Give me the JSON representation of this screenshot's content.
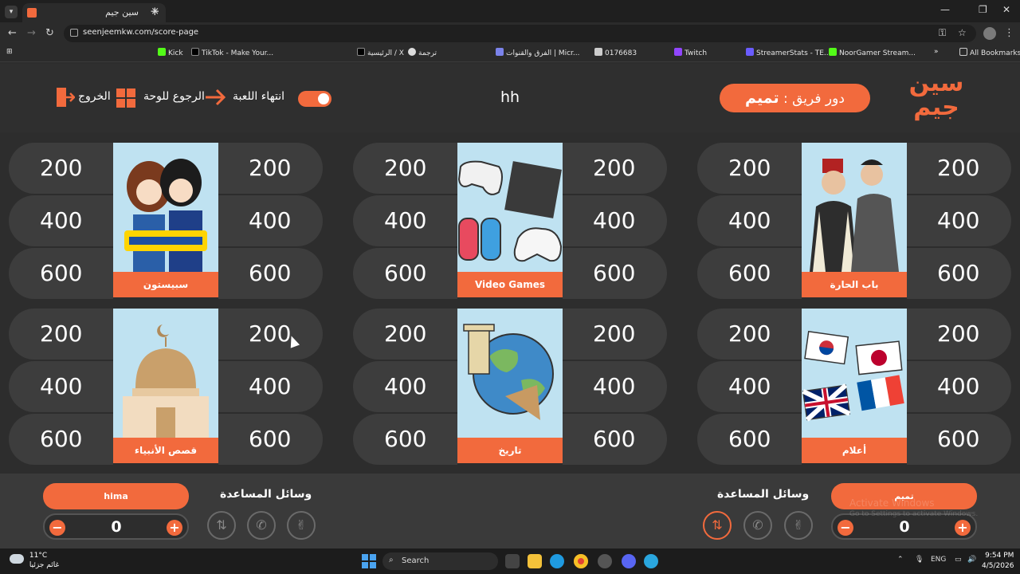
{
  "browser": {
    "tab_title": "سين جيم",
    "url": "seenjeemkw.com/score-page",
    "bookmarks": [
      "Kick",
      "TikTok - Make Your...",
      "الرئيسية / X",
      "ترجمة",
      "الفرق والقنوات | Micr...",
      "0176683",
      "Twitch",
      "StreamerStats - TE...",
      "NoorGamer Stream..."
    ],
    "all_bookmarks": "All Bookmarks"
  },
  "header": {
    "logo_text": "سين جيم",
    "turn_label": "دور فريق :",
    "turn_team": "تميم",
    "game_name": "hh",
    "end_game": "انتهاء اللعبة",
    "back_to_board": "الرجوع للوحة",
    "exit": "الخروج"
  },
  "board": {
    "categories": [
      {
        "name": "سبيستون",
        "left_values": [
          "200",
          "400",
          "600"
        ],
        "right_values": [
          "200",
          "400",
          "600"
        ]
      },
      {
        "name": "Video Games",
        "left_values": [
          "200",
          "400",
          "600"
        ],
        "right_values": [
          "200",
          "400",
          "600"
        ]
      },
      {
        "name": "باب الحارة",
        "left_values": [
          "200",
          "400",
          "600"
        ],
        "right_values": [
          "200",
          "400",
          "600"
        ]
      },
      {
        "name": "قصص الأنبياء",
        "left_values": [
          "200",
          "400",
          "600"
        ],
        "right_values": [
          "200",
          "400",
          "600"
        ]
      },
      {
        "name": "تاريخ",
        "left_values": [
          "200",
          "400",
          "600"
        ],
        "right_values": [
          "200",
          "400",
          "600"
        ]
      },
      {
        "name": "أعلام",
        "left_values": [
          "200",
          "400",
          "600"
        ],
        "right_values": [
          "200",
          "400",
          "600"
        ]
      }
    ]
  },
  "teams": {
    "left": {
      "name": "hima",
      "score": "0",
      "help_title": "وسائل المساعدة"
    },
    "right": {
      "name": "تميم",
      "score": "0",
      "help_title": "وسائل المساعدة"
    }
  },
  "watermark": {
    "line1": "Activate Windows",
    "line2": "Go to Settings to activate Windows."
  },
  "taskbar": {
    "weather_temp": "11°C",
    "weather_desc": "غائم جزئيا",
    "search": "Search",
    "lang": "ENG",
    "time": "9:54 PM",
    "date": "4/5/2026"
  },
  "colors": {
    "accent": "#f26a3d",
    "bg": "#2d2d2d",
    "pill": "#3d3d3d"
  }
}
